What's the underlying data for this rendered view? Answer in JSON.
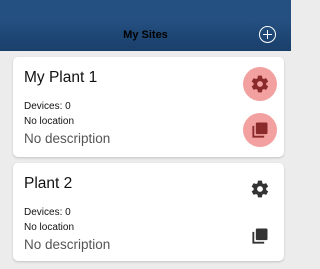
{
  "header": {
    "title": "My Sites",
    "add_icon": "plus-circle-icon"
  },
  "sites": [
    {
      "name": "My Plant 1",
      "devices": "Devices: 0",
      "location": "No location",
      "description": "No description",
      "settings_icon": "gear-icon",
      "copy_icon": "copy-icon",
      "icon_color": "#8b2a2a",
      "icon_bg": "#f2a0a0"
    },
    {
      "name": "Plant 2",
      "devices": "Devices: 0",
      "location": "No location",
      "description": "No description",
      "settings_icon": "gear-icon",
      "copy_icon": "copy-icon",
      "icon_color": "#333333"
    }
  ]
}
